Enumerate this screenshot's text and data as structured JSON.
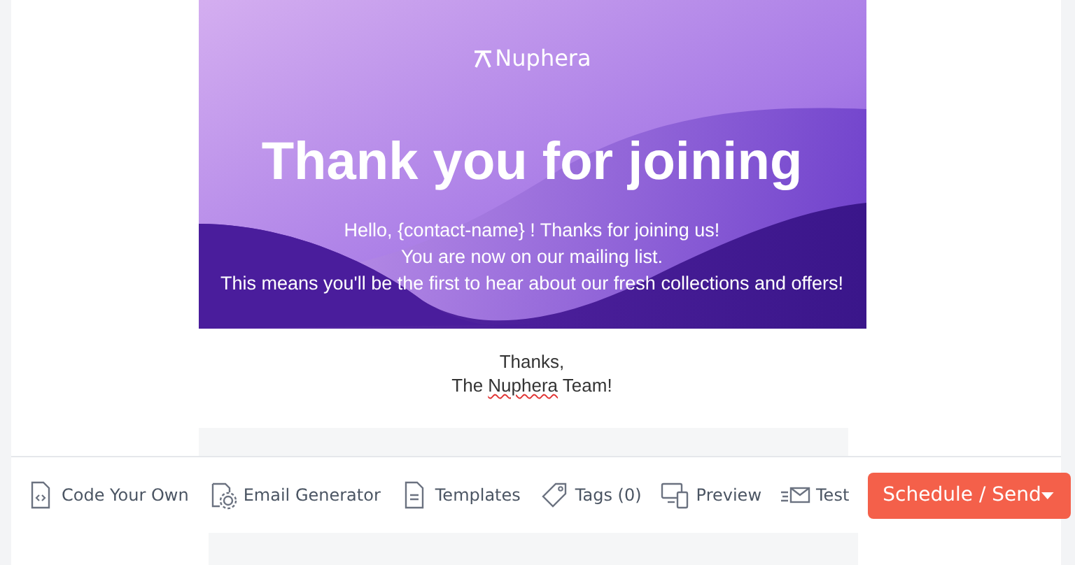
{
  "email": {
    "banner": {
      "logo": "Nuphera",
      "headline": "Thank you for joining",
      "lines": [
        "Hello, {contact-name} ! Thanks for joining us!",
        "You are now on our mailing list.",
        "This means you'll be the first to hear about our fresh collections and offers!"
      ]
    },
    "signoff": {
      "line1": "Thanks,",
      "line2": {
        "before": "The ",
        "misspelled": "Nuphera",
        "after": " Team!"
      }
    }
  },
  "toolbar": {
    "items": [
      {
        "kind": "code",
        "label": "Code Your Own"
      },
      {
        "kind": "generator",
        "label": "Email Generator"
      },
      {
        "kind": "templates",
        "label": "Templates"
      },
      {
        "kind": "tags",
        "label": "Tags (0)"
      },
      {
        "kind": "preview",
        "label": "Preview"
      },
      {
        "kind": "test",
        "label": "Test"
      }
    ],
    "send_button": {
      "label": "Schedule / Send"
    }
  }
}
